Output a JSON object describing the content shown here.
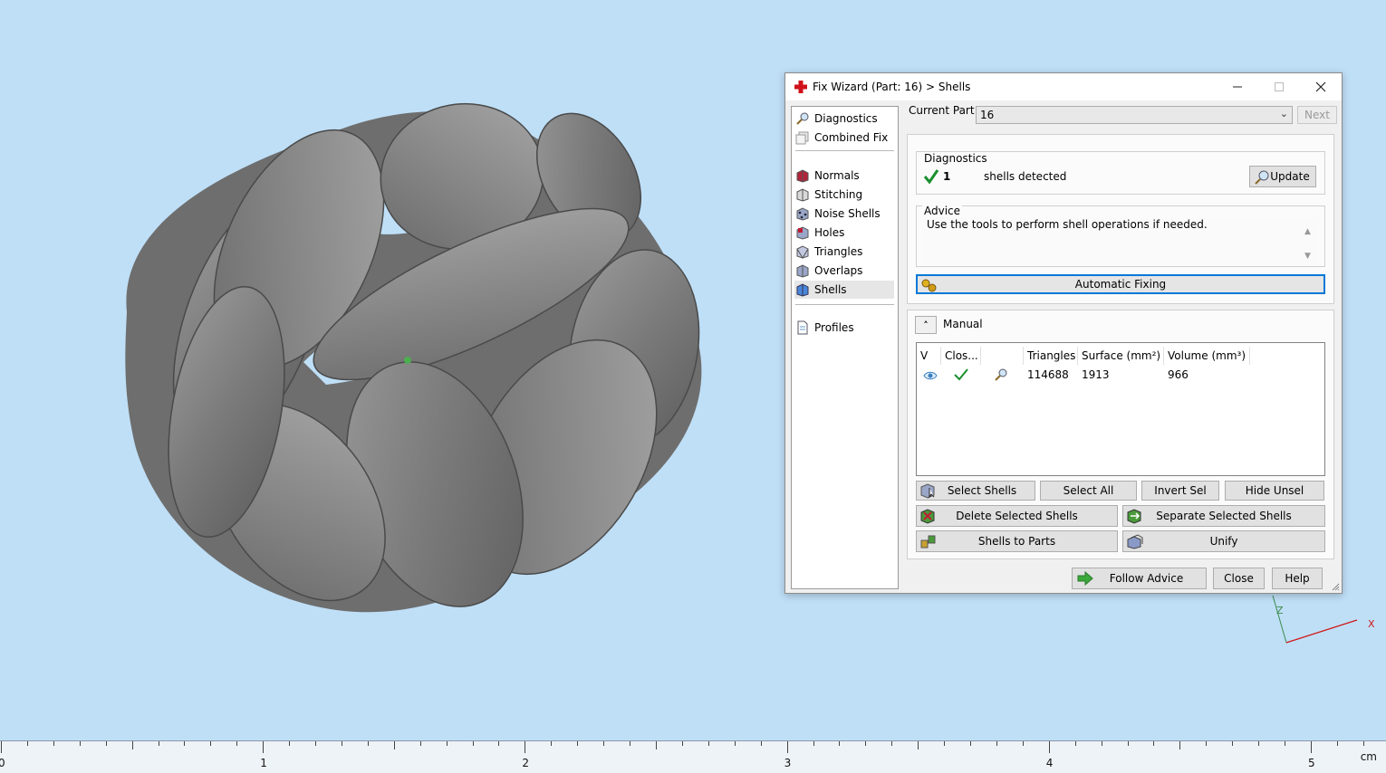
{
  "dialog": {
    "title": "Fix Wizard (Part: 16) > Shells",
    "min_icon": "minimize-icon",
    "max_icon": "maximize-icon",
    "close_icon": "close-icon"
  },
  "nav": {
    "items": [
      {
        "label": "Diagnostics",
        "icon": "magnifier-icon"
      },
      {
        "label": "Combined Fix",
        "icon": "combined-fix-icon"
      },
      {
        "label": "Normals",
        "icon": "normals-icon"
      },
      {
        "label": "Stitching",
        "icon": "stitching-icon"
      },
      {
        "label": "Noise Shells",
        "icon": "noise-shells-icon"
      },
      {
        "label": "Holes",
        "icon": "holes-icon"
      },
      {
        "label": "Triangles",
        "icon": "triangles-icon"
      },
      {
        "label": "Overlaps",
        "icon": "overlaps-icon"
      },
      {
        "label": "Shells",
        "icon": "shells-icon"
      },
      {
        "label": "Profiles",
        "icon": "profiles-icon"
      }
    ],
    "selected": "Shells"
  },
  "current_part": {
    "label": "Current Part:",
    "value": "16",
    "next_label": "Next"
  },
  "diagnostics": {
    "legend": "Diagnostics",
    "count": "1",
    "text": "shells detected",
    "update_label": "Update"
  },
  "advice": {
    "legend": "Advice",
    "text": "Use the tools to perform shell operations if needed.",
    "auto_fix_label": "Automatic Fixing"
  },
  "manual": {
    "label": "Manual",
    "columns": [
      "V",
      "Clos...",
      "",
      "Triangles",
      "Surface (mm²)",
      "Volume (mm³)"
    ],
    "rows": [
      {
        "visible": true,
        "closed": true,
        "triangles": "114688",
        "surface": "1913",
        "volume": "966"
      }
    ],
    "buttons": {
      "select_shells": "Select Shells",
      "select_all": "Select All",
      "invert_sel": "Invert Sel",
      "hide_unsel": "Hide Unsel",
      "delete_selected": "Delete Selected Shells",
      "separate_selected": "Separate Selected Shells",
      "shells_to_parts": "Shells to Parts",
      "unify": "Unify"
    }
  },
  "footer": {
    "follow_advice": "Follow Advice",
    "close": "Close",
    "help": "Help"
  },
  "ruler": {
    "labels": [
      "0",
      "1",
      "2",
      "3",
      "4",
      "5"
    ],
    "unit": "cm"
  },
  "axis": {
    "x_label": "X",
    "z_label": "Z"
  },
  "colors": {
    "background": "#bfdff7",
    "check": "#1a8f2e",
    "accent": "#0078d7"
  }
}
